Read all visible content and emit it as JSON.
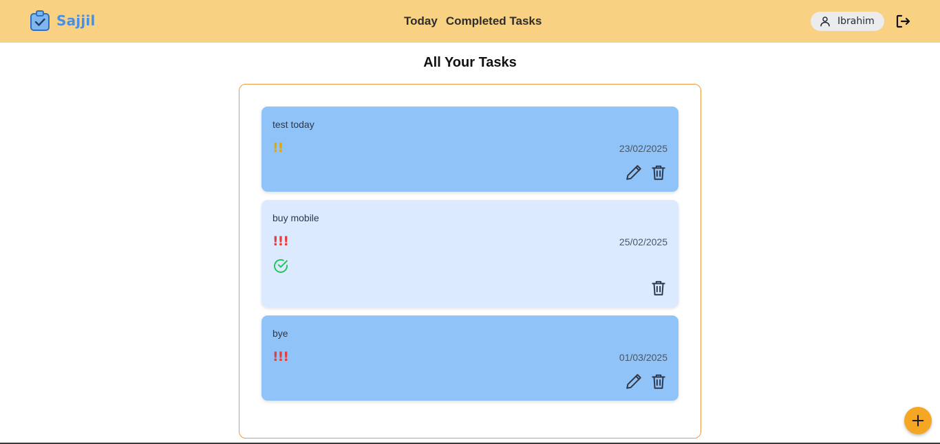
{
  "app": {
    "brand_name": "Sajjil",
    "brand_color": "#4a90e2",
    "header_color": "#f9d183"
  },
  "nav": {
    "links": [
      {
        "label": "Today"
      },
      {
        "label": "Completed Tasks"
      }
    ]
  },
  "user": {
    "name": "Ibrahim",
    "icon": "user-icon",
    "logout_icon": "logout-icon"
  },
  "page": {
    "title": "All Your Tasks",
    "panel_border_color": "#ee9a3b"
  },
  "tasks": [
    {
      "title": "test today",
      "priority": "!!",
      "priority_color": "#e0a800",
      "date": "23/02/2025",
      "completed": false,
      "card_color": "#90c3f8"
    },
    {
      "title": "buy mobile",
      "priority": "!!!",
      "priority_color": "#e53e3e",
      "date": "25/02/2025",
      "completed": true,
      "card_color": "#dbeafe"
    },
    {
      "title": "bye",
      "priority": "!!!",
      "priority_color": "#e53e3e",
      "date": "01/03/2025",
      "completed": false,
      "card_color": "#90c3f8"
    }
  ],
  "fab": {
    "icon": "plus-icon",
    "color": "#f5a623"
  }
}
